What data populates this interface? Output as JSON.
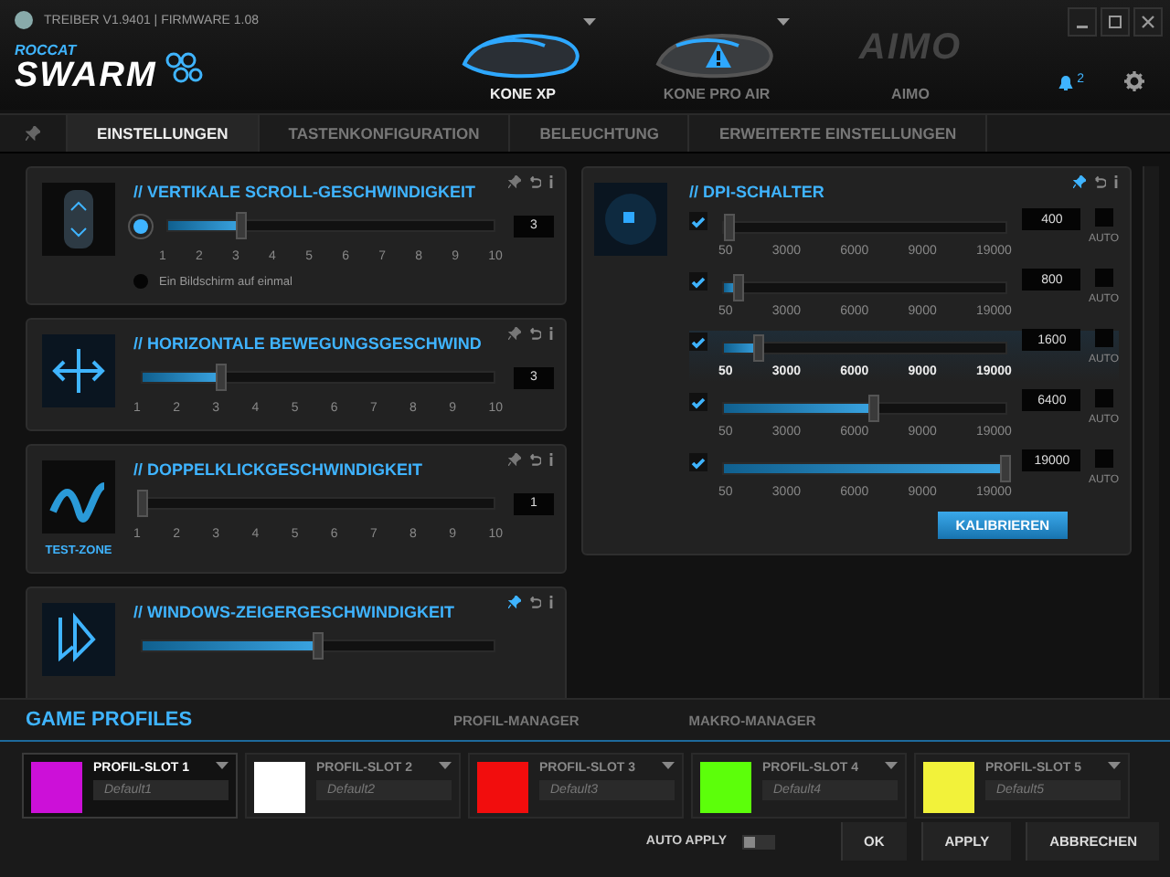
{
  "window": {
    "info": "TREIBER V1.9401 | FIRMWARE 1.08",
    "brand": "ROCCAT",
    "product": "SWARM"
  },
  "devices": [
    {
      "name": "KONE XP",
      "kind": "mouse",
      "selected": true,
      "warning": false
    },
    {
      "name": "KONE PRO AIR",
      "kind": "mouse",
      "selected": false,
      "warning": true
    },
    {
      "name": "AIMO",
      "kind": "logo",
      "logo_text": "AIMO",
      "selected": false
    }
  ],
  "notifications": "2",
  "tabs": [
    {
      "label": "EINSTELLUNGEN",
      "selected": true
    },
    {
      "label": "TASTENKONFIGURATION",
      "selected": false
    },
    {
      "label": "BELEUCHTUNG",
      "selected": false
    },
    {
      "label": "ERWEITERTE EINSTELLUNGEN",
      "selected": false
    }
  ],
  "settings_cards": [
    {
      "kind": "scroll",
      "title": "// VERTIKALE SCROLL-GESCHWINDIGKEIT",
      "pinned": false,
      "level": 0.222,
      "ticks": [
        "1",
        "2",
        "3",
        "4",
        "5",
        "6",
        "7",
        "8",
        "9",
        "10"
      ],
      "value": "3",
      "options": [
        {
          "selected": true
        },
        {
          "label": "Ein Bildschirm auf einmal",
          "selected": false
        }
      ]
    },
    {
      "kind": "horizontal",
      "title": "// HORIZONTALE BEWEGUNGSGESCHWIND",
      "pinned": false,
      "level": 0.222,
      "ticks": [
        "1",
        "2",
        "3",
        "4",
        "5",
        "6",
        "7",
        "8",
        "9",
        "10"
      ],
      "value": "3"
    },
    {
      "kind": "doubleclick",
      "title": "// DOPPELKLICKGESCHWINDIGKEIT",
      "pinned": false,
      "level": 0,
      "ticks": [
        "1",
        "2",
        "3",
        "4",
        "5",
        "6",
        "7",
        "8",
        "9",
        "10"
      ],
      "value": "1",
      "caption": "TEST-ZONE"
    },
    {
      "kind": "pointer",
      "title": "// WINDOWS-ZEIGERGESCHWINDIGKEIT",
      "pinned": true,
      "level": 0.5
    }
  ],
  "dpi": {
    "title": "// DPI-SCHALTER",
    "pinned": true,
    "button": "KALIBRIEREN",
    "rows": [
      {
        "checked": true,
        "level": 0.02,
        "value": "400",
        "auto": false,
        "auto_label": "AUTO",
        "selected": false,
        "ticks": [
          "50",
          "3000",
          "6000",
          "9000",
          "19000"
        ]
      },
      {
        "checked": true,
        "level": 0.05,
        "value": "800",
        "auto": false,
        "auto_label": "AUTO",
        "selected": false,
        "ticks": [
          "50",
          "3000",
          "6000",
          "9000",
          "19000"
        ]
      },
      {
        "checked": true,
        "level": 0.12,
        "value": "1600",
        "auto": false,
        "auto_label": "AUTO",
        "selected": true,
        "ticks": [
          "50",
          "3000",
          "6000",
          "9000",
          "19000"
        ]
      },
      {
        "checked": true,
        "level": 0.53,
        "value": "6400",
        "auto": false,
        "auto_label": "AUTO",
        "selected": false,
        "ticks": [
          "50",
          "3000",
          "6000",
          "9000",
          "19000"
        ]
      },
      {
        "checked": true,
        "level": 1,
        "value": "19000",
        "auto": false,
        "auto_label": "AUTO",
        "selected": false,
        "ticks": [
          "50",
          "3000",
          "6000",
          "9000",
          "19000"
        ]
      }
    ]
  },
  "profiles": {
    "title": "GAME PROFILES",
    "tabs": [
      "PROFIL-MANAGER",
      "MAKRO-MANAGER"
    ],
    "slots": [
      {
        "label": "PROFIL-SLOT 1",
        "name": "Default1",
        "color": "#cc10d8",
        "selected": true
      },
      {
        "label": "PROFIL-SLOT 2",
        "name": "Default2",
        "color": "#ffffff",
        "selected": false
      },
      {
        "label": "PROFIL-SLOT 3",
        "name": "Default3",
        "color": "#f20d0d",
        "selected": false
      },
      {
        "label": "PROFIL-SLOT 4",
        "name": "Default4",
        "color": "#5cff0a",
        "selected": false
      },
      {
        "label": "PROFIL-SLOT 5",
        "name": "Default5",
        "color": "#f2f23a",
        "selected": false
      }
    ]
  },
  "footer": {
    "auto_apply_label": "AUTO APPLY",
    "auto_apply": false,
    "buttons": [
      "OK",
      "APPLY",
      "ABBRECHEN"
    ]
  }
}
